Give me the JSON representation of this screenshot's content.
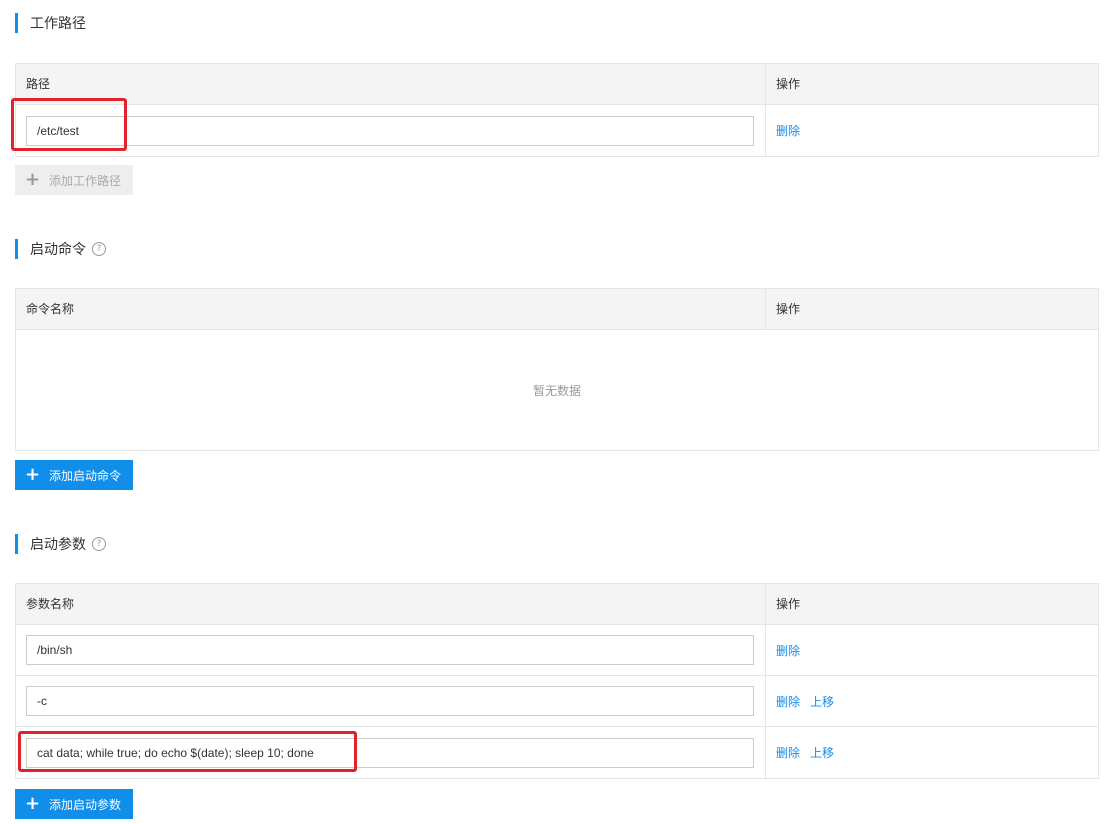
{
  "workdir": {
    "title": "工作路径",
    "headers": {
      "name": "路径",
      "op": "操作"
    },
    "rows": [
      {
        "value": "/etc/test",
        "actions": [
          "删除"
        ]
      }
    ],
    "add_label": "添加工作路径"
  },
  "command": {
    "title": "启动命令",
    "help_icon": "?",
    "headers": {
      "name": "命令名称",
      "op": "操作"
    },
    "empty_text": "暂无数据",
    "add_label": "添加启动命令"
  },
  "params": {
    "title": "启动参数",
    "help_icon": "?",
    "headers": {
      "name": "参数名称",
      "op": "操作"
    },
    "rows": [
      {
        "value": "/bin/sh",
        "actions": [
          "删除"
        ]
      },
      {
        "value": "-c",
        "actions": [
          "删除",
          "上移"
        ]
      },
      {
        "value": "cat data; while true; do echo $(date); sleep 10; done",
        "actions": [
          "删除",
          "上移"
        ]
      }
    ],
    "add_label": "添加启动参数"
  },
  "icons": {
    "plus": "+"
  },
  "colors": {
    "primary": "#108ee9",
    "highlight": "#e3232b"
  }
}
